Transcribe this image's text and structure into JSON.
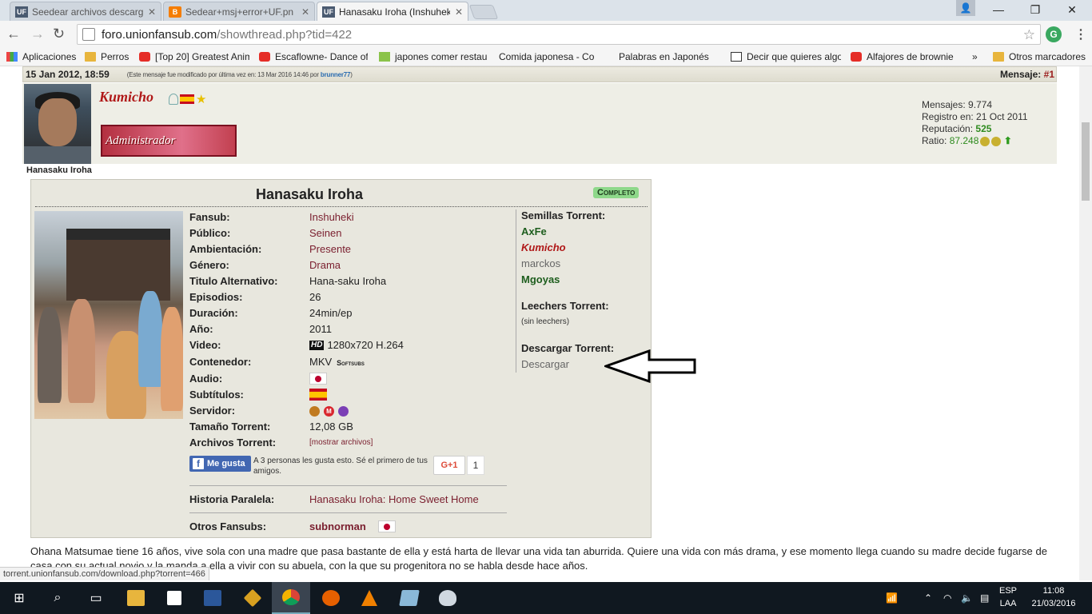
{
  "browser": {
    "tabs": [
      {
        "title": "Seedear archivos descarg",
        "icon": "UF"
      },
      {
        "title": "Sedear+msj+error+UF.pn",
        "icon": "B"
      },
      {
        "title": "Hanasaku Iroha (Inshuhek",
        "icon": "UF",
        "active": true
      }
    ],
    "url_host": "foro.unionfansub.com",
    "url_path": "/showthread.php?tid=422",
    "bookmarks": [
      {
        "label": "Aplicaciones",
        "icon": "apps"
      },
      {
        "label": "Perros",
        "icon": "folder"
      },
      {
        "label": "[Top 20] Greatest Anim",
        "icon": "yt"
      },
      {
        "label": "Escaflowne- Dance of",
        "icon": "yt"
      },
      {
        "label": "japones comer restau",
        "icon": "leaf"
      },
      {
        "label": "Comida japonesa - Co",
        "icon": "page"
      },
      {
        "label": "Palabras en Japonés",
        "icon": "page"
      },
      {
        "label": "Decir que quieres algo",
        "icon": "ban"
      },
      {
        "label": "Alfajores de brownie",
        "icon": "yt"
      }
    ],
    "bookmarks_more": "»",
    "other_bookmarks": "Otros marcadores",
    "status_url": "torrent.unionfansub.com/download.php?torrent=466"
  },
  "post": {
    "date": "15 Jan 2012, 18:59",
    "modified_note": "(Este mensaje fue modificado por última vez en: 13 Mar 2016 14:46 por ",
    "modified_by": "brunner77",
    "modified_close": ")",
    "message_label": "Mensaje: ",
    "message_num": "#1",
    "username": "Kumicho",
    "badge": "Administrador",
    "signature_title": "Hanasaku Iroha",
    "stats": {
      "mensajes_label": "Mensajes: ",
      "mensajes": "9.774",
      "registro_label": "Registro en: ",
      "registro": "21 Oct 2011",
      "reputacion_label": "Reputación: ",
      "reputacion": "525",
      "ratio_label": "Ratio: ",
      "ratio": "87.248"
    }
  },
  "info": {
    "title": "Hanasaku Iroha",
    "status": "Completo",
    "fields": [
      {
        "k": "Fansub:",
        "v": "Inshuheki"
      },
      {
        "k": "Público:",
        "v": "Seinen"
      },
      {
        "k": "Ambientación:",
        "v": "Presente"
      },
      {
        "k": "Género:",
        "v": "Drama"
      },
      {
        "k": "Titulo Alternativo:",
        "v": "Hana-saku Iroha"
      },
      {
        "k": "Episodios:",
        "v": "26"
      },
      {
        "k": "Duración:",
        "v": "24min/ep"
      },
      {
        "k": "Año:",
        "v": "2011"
      },
      {
        "k": "Video:",
        "v": "1280x720 H.264"
      },
      {
        "k": "Contenedor:",
        "v": "MKV"
      },
      {
        "k": "Audio:",
        "v": ""
      },
      {
        "k": "Subtítulos:",
        "v": ""
      },
      {
        "k": "Servidor:",
        "v": ""
      },
      {
        "k": "Tamaño Torrent:",
        "v": "12,08 GB"
      },
      {
        "k": "Archivos Torrent:",
        "v": "[mostrar archivos]"
      }
    ],
    "hd_label": "HD",
    "softsubs": "Softsubs",
    "fb_like": "Me gusta",
    "fb_text": "A 3 personas les gusta esto. Sé el primero de tus amigos.",
    "gplus": "G+1",
    "gplus_count": "1",
    "historia_label": "Historia Paralela:",
    "historia_value": "Hanasaku Iroha: Home Sweet Home",
    "otros_label": "Otros Fansubs:",
    "otros_value": "subnorman",
    "seeds_title": "Semillas Torrent:",
    "seeds": [
      "AxFe",
      "Kumicho",
      "marckos",
      "Mgoyas"
    ],
    "leechers_title": "Leechers Torrent:",
    "leechers_none": "(sin leechers)",
    "download_title": "Descargar Torrent:",
    "download_link": "Descargar"
  },
  "description": "Ohana Matsumae tiene 16 años, vive sola con una madre que pasa bastante de ella y está harta de llevar una vida tan aburrida. Quiere una vida con más drama, y ese momento llega cuando su madre decide fugarse de casa con su actual novio y la manda a ella a vivir con su abuela, con la que su progenitora no se habla desde hace años.",
  "taskbar": {
    "lang_top": "ESP",
    "lang_bottom": "LAA",
    "time": "11:08",
    "date": "21/03/2016"
  }
}
